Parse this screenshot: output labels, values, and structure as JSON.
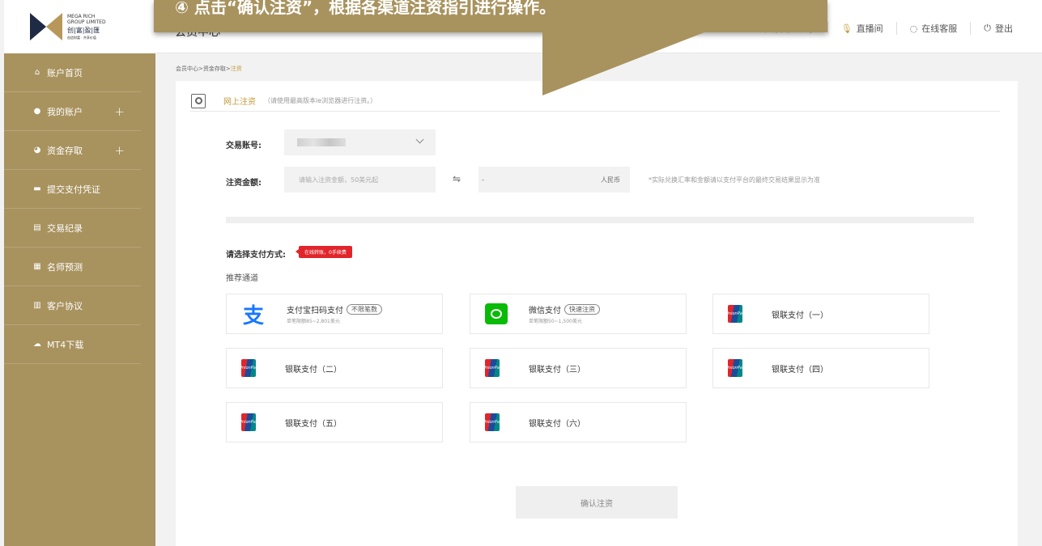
{
  "logo": {
    "line1": "MEGA RICH",
    "line2": "GROUP LIMITED",
    "cn": "创|富|盈|匯",
    "tagline": "创造财富 · 共享价值"
  },
  "sidebar": {
    "items": [
      {
        "label": "账户首页",
        "icon": "home-icon",
        "glyph": "⌂"
      },
      {
        "label": "我的账户",
        "icon": "user-icon",
        "glyph": "●",
        "expand": "+"
      },
      {
        "label": "资金存取",
        "icon": "pie-icon",
        "glyph": "◕",
        "expand": "+"
      },
      {
        "label": "提交支付凭证",
        "icon": "card-icon",
        "glyph": "▬"
      },
      {
        "label": "交易纪录",
        "icon": "folder-icon",
        "glyph": "▤"
      },
      {
        "label": "名师预测",
        "icon": "chart-icon",
        "glyph": "▦"
      },
      {
        "label": "客户协议",
        "icon": "doc-icon",
        "glyph": "▥"
      },
      {
        "label": "MT4下载",
        "icon": "cloud-icon",
        "glyph": "☁"
      }
    ]
  },
  "topbar": {
    "title": "会员中心",
    "links": [
      {
        "label": "申请模拟账号",
        "icon": ""
      },
      {
        "label": "直播间",
        "icon": "mic-icon",
        "glyph": "🎙"
      },
      {
        "label": "在线客服",
        "icon": "headset-icon",
        "glyph": "◌"
      },
      {
        "label": "登出",
        "icon": "power-icon",
        "glyph": "⏻"
      }
    ]
  },
  "callout": {
    "text": "④ 点击“确认注资”，根据各渠道注资指引进行操作。"
  },
  "breadcrumb": {
    "root": "会员中心>资金存取>",
    "current": "注资"
  },
  "section": {
    "title": "网上注资",
    "note": "（请使用最高版本ie浏览器进行注资。）"
  },
  "form": {
    "account_label": "交易账号:",
    "amount_label": "注资金额:",
    "amount_placeholder": "请输入注资金额，50美元起",
    "swap_glyph": "⇋",
    "rmb_value": "-",
    "rmb_unit": "人民币",
    "rate_note": "*实际兑换汇率和金额请以支付平台的最终交易结果显示为准"
  },
  "payment": {
    "label": "请选择支付方式:",
    "badge": "在线转账，0手续费",
    "recommended": "推荐通道",
    "methods": [
      {
        "name": "支付宝扫码支付",
        "tag": "不限笔数",
        "limit": "单笔限额85~2,801美元",
        "logo": "alipay",
        "glyph": "支"
      },
      {
        "name": "微信支付",
        "tag": "快速注资",
        "limit": "单笔限额50~1,500美元",
        "logo": "wechat",
        "glyph": ""
      },
      {
        "name": "银联支付（一）",
        "tag": "",
        "limit": "",
        "logo": "unionpay",
        "glyph": "UnionPay"
      },
      {
        "name": "银联支付（二）",
        "tag": "",
        "limit": "",
        "logo": "unionpay",
        "glyph": "UnionPay"
      },
      {
        "name": "银联支付（三）",
        "tag": "",
        "limit": "",
        "logo": "unionpay",
        "glyph": "UnionPay"
      },
      {
        "name": "银联支付（四）",
        "tag": "",
        "limit": "",
        "logo": "unionpay",
        "glyph": "UnionPay"
      },
      {
        "name": "银联支付（五）",
        "tag": "",
        "limit": "",
        "logo": "unionpay",
        "glyph": "UnionPay"
      },
      {
        "name": "银联支付（六）",
        "tag": "",
        "limit": "",
        "logo": "unionpay",
        "glyph": "UnionPay"
      }
    ]
  },
  "confirm_label": "确认注资",
  "colors": {
    "gold": "#a8925e",
    "accent": "#c59a3c",
    "badge_red": "#e1252b"
  }
}
